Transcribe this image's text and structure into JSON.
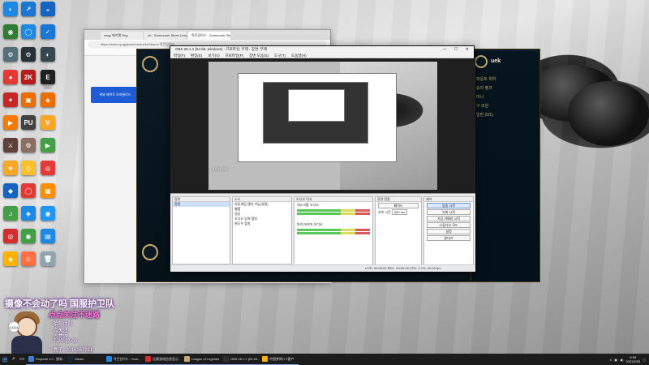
{
  "desktop": {
    "icons_col1": [
      {
        "label": "",
        "color": "#1e88e5",
        "glyph": "◐"
      },
      {
        "label": "",
        "color": "#2e7d32",
        "glyph": "◉"
      },
      {
        "label": "",
        "color": "#546e7a",
        "glyph": "⚙"
      },
      {
        "label": "",
        "color": "#e53935",
        "glyph": "●"
      },
      {
        "label": "",
        "color": "#c62828",
        "glyph": "✦"
      },
      {
        "label": "",
        "color": "#f57c00",
        "glyph": "▶"
      },
      {
        "label": "",
        "color": "#5d4037",
        "glyph": "⚔"
      },
      {
        "label": "",
        "color": "#f9a825",
        "glyph": "★"
      },
      {
        "label": "",
        "color": "#1565c0",
        "glyph": "◆"
      },
      {
        "label": "",
        "color": "#43a047",
        "glyph": "♫"
      },
      {
        "label": "",
        "color": "#d32f2f",
        "glyph": "◎"
      },
      {
        "label": "",
        "color": "#ffb300",
        "glyph": "◈"
      }
    ],
    "icons_col2": [
      {
        "label": "",
        "color": "#1976d2",
        "glyph": "↗"
      },
      {
        "label": "",
        "color": "#1e88e5",
        "glyph": "◯"
      },
      {
        "label": "",
        "color": "#263238",
        "glyph": "⚙"
      },
      {
        "label": "",
        "color": "#b71c1c",
        "glyph": "2K"
      },
      {
        "label": "",
        "color": "#ef6c00",
        "glyph": "▣"
      },
      {
        "label": "",
        "color": "#424242",
        "glyph": "PU"
      },
      {
        "label": "",
        "color": "#8d6e63",
        "glyph": "⚙"
      },
      {
        "label": "",
        "color": "#fbc02d",
        "glyph": "◇"
      },
      {
        "label": "",
        "color": "#e53935",
        "glyph": "◯"
      },
      {
        "label": "",
        "color": "#1e88e5",
        "glyph": "◈"
      },
      {
        "label": "",
        "color": "#43a047",
        "glyph": "◉"
      },
      {
        "label": "",
        "color": "#ff7043",
        "glyph": "☺"
      }
    ],
    "icons_col3": [
      {
        "label": "",
        "color": "#1565c0",
        "glyph": "◒"
      },
      {
        "label": "",
        "color": "#1976d2",
        "glyph": "✓"
      },
      {
        "label": "",
        "color": "#37474f",
        "glyph": "◐"
      },
      {
        "label": "EPIC",
        "color": "#212121",
        "glyph": "E"
      },
      {
        "label": "",
        "color": "#ef6c00",
        "glyph": "◈"
      },
      {
        "label": "",
        "color": "#f9a825",
        "glyph": "V"
      },
      {
        "label": "",
        "color": "#43a047",
        "glyph": "▶"
      },
      {
        "label": "",
        "color": "#e53935",
        "glyph": "◎"
      },
      {
        "label": "",
        "color": "#ff8f00",
        "glyph": "▦"
      },
      {
        "label": "",
        "color": "#2196f3",
        "glyph": "◉"
      },
      {
        "label": "",
        "color": "#1e88e5",
        "glyph": "▤"
      },
      {
        "label": "",
        "color": "#90a4ae",
        "glyph": "🗑"
      }
    ]
  },
  "browser": {
    "tabs": [
      "naqp 패키웨 Rng",
      "ub - Summoner Sleen League",
      "락큰길이드 - Summoner Sleen"
    ],
    "address": "https://www.op.gg/summoners/kr/Search 락큰길이드",
    "banner": "위와 페이트 모하빌로드"
  },
  "lol_client": {
    "username": "uek",
    "status_lines": [
      "파운트 위하",
      "승리 랭크",
      "마니",
      "구 모원",
      "일반 (0/1)"
    ]
  },
  "obs": {
    "title": "OBS 26.1.1 (64-bit, windows) - 프로파일: 무제 - 장면: 무제",
    "menu": [
      "파일(F)",
      "편집(E)",
      "보기(V)",
      "프로파일(P)",
      "장면 모음(S)",
      "도구(T)",
      "도움말(H)"
    ],
    "overlay_caption": "쿠르키 소비",
    "docks": {
      "scenes": {
        "header": "장면",
        "items": [
          "장면"
        ]
      },
      "sources": {
        "header": "소스",
        "items": [
          "자동게임 캡처 가능(설정)",
          "웹캠",
          "영상",
          "오디오 입력 캡처",
          "윈도우 캡처"
        ]
      },
      "mixer": {
        "header": "오디오 믹서",
        "rows": [
          "데스크톱 오디오",
          "마이크/보조 오디오"
        ]
      },
      "transitions": {
        "header": "장면 전환",
        "fade": "페이드",
        "duration_label": "지속 시간",
        "duration": "300 ms"
      },
      "controls": {
        "header": "제어",
        "buttons": [
          "방송 시작",
          "녹화 시작",
          "가상 카메라 시작",
          "스튜디오 모드",
          "설정",
          "끝내기"
        ]
      }
    },
    "status": "LIVE: 00:00:00   REC: 00:00:00   CPU: 2.1%, 30.00 fps"
  },
  "overlay": {
    "title": "摄像不会动了吗 国服护卫队",
    "subtitle": "点点关注不迷路",
    "lines": [
      "· 拾叫体队",
      "· 点关注·",
      "· 点赞评",
      "· 7·00-12·00",
      "· 盒子: 2016167911"
    ],
    "badge": "点点关注"
  },
  "taskbar": {
    "apps": [
      {
        "label": "Emporia 1.0 - 图标...",
        "color": "#3f7fd1"
      },
      {
        "label": "Steam",
        "color": "#1b2838"
      },
      {
        "label": "락큰길이드 - Sum...",
        "color": "#1e88e5"
      },
      {
        "label": "比赛游戏信息显示",
        "color": "#d32f2f"
      },
      {
        "label": "League of Legends",
        "color": "#c8aa6e"
      },
      {
        "label": "OBS 26.1.1 (64 bit...",
        "color": "#302e31"
      },
      {
        "label": "中国梦网/YY客户",
        "color": "#ffb300"
      }
    ],
    "time": "6:39",
    "date": "2021/2/25"
  }
}
